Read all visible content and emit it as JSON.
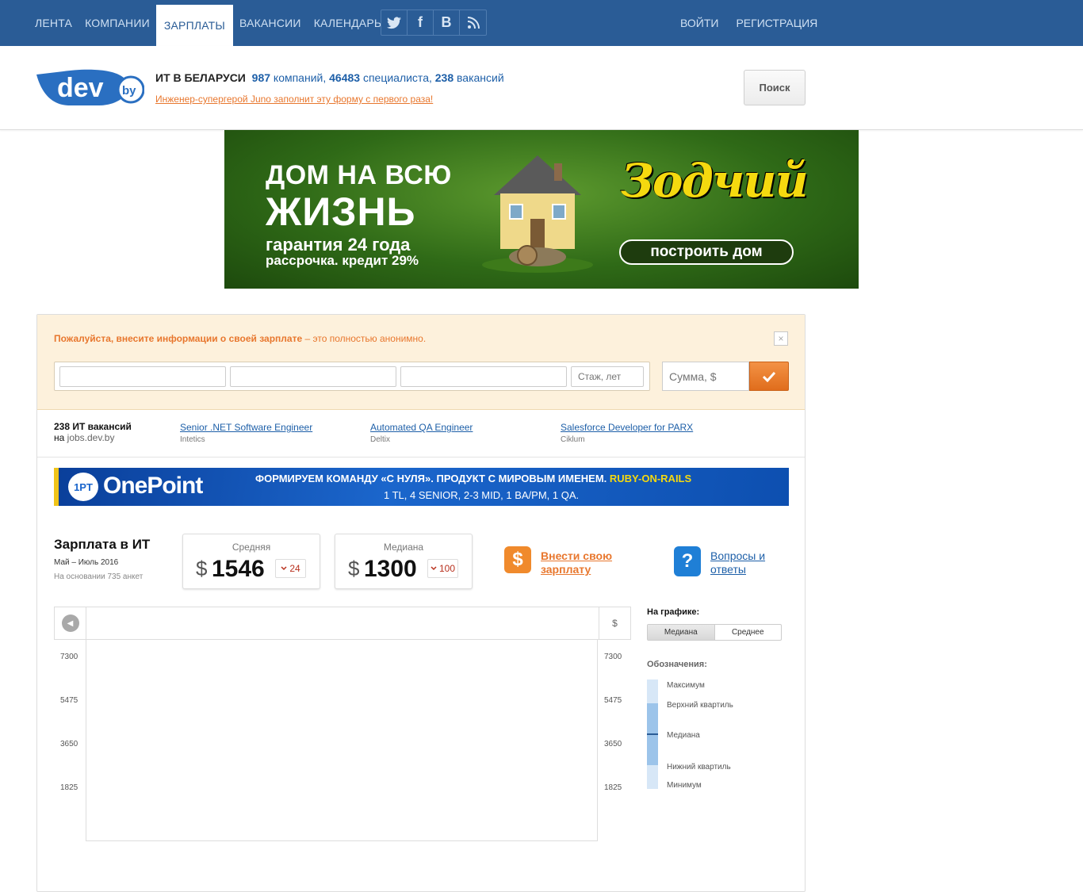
{
  "nav": {
    "items": [
      "ЛЕНТА",
      "КОМПАНИИ",
      "ЗАРПЛАТЫ",
      "ВАКАНСИИ",
      "КАЛЕНДАРЬ"
    ],
    "active": "ЗАРПЛАТЫ",
    "social": [
      "twitter-icon",
      "facebook-icon",
      "vkontakte-icon",
      "rss-icon"
    ],
    "login": "ВОЙТИ",
    "register": "РЕГИСТРАЦИЯ"
  },
  "header": {
    "logo_text": "dev",
    "logo_suffix": "by",
    "tagline_prefix": "ИТ В БЕЛАРУСИ",
    "companies_count": "987",
    "companies_label": "компаний,",
    "specialists_count": "46483",
    "specialists_label": "специалиста,",
    "vacancies_count": "238",
    "vacancies_label": "вакансий",
    "promo_link": "Инженер-супергерой Juno заполнит эту форму с первого раза!",
    "search_button": "Поиск"
  },
  "banner": {
    "line1": "ДОМ НА ВСЮ",
    "line2": "ЖИЗНЬ",
    "line3": "гарантия 24 года",
    "line4": "рассрочка. кредит 29%",
    "brand": "Зодчий",
    "button": "построить дом"
  },
  "salary_form": {
    "prompt_bold": "Пожалуйста, внесите информации о своей зарплате",
    "prompt_rest": " – это полностью анонимно.",
    "close": "×",
    "field1_placeholder": "",
    "field2_placeholder": "",
    "field3_placeholder": "",
    "experience_placeholder": "Стаж, лет",
    "sum_placeholder": "Сумма, $",
    "submit_icon": "checkmark-icon"
  },
  "jobs": {
    "count_label": "238 ИТ вакансий",
    "site_prefix": "на",
    "site": "jobs.dev.by",
    "items": [
      {
        "title": "Senior .NET Software Engineer",
        "company": "Intetics"
      },
      {
        "title": "Automated QA Engineer",
        "company": "Deltix"
      },
      {
        "title": "Salesforce Developer for PARX",
        "company": "Ciklum"
      }
    ]
  },
  "onepoint": {
    "logo": "1PT",
    "name": "OnePoint",
    "line1": "ФОРМИРУЕМ КОМАНДУ «С НУЛЯ». ПРОДУКТ С МИРОВЫМ ИМЕНЕМ.",
    "line1_accent": "RUBY-ON-RAILS",
    "line2": "1 TL, 4 SENIOR, 2-3 MID, 1 BA/PM, 1 QA."
  },
  "stats": {
    "title": "Зарплата в ИТ",
    "period": "Май – Июль 2016",
    "basis": "На основании 735 анкет",
    "average": {
      "label": "Средняя",
      "currency": "$",
      "value": "1546",
      "delta": "24"
    },
    "median": {
      "label": "Медиана",
      "currency": "$",
      "value": "1300",
      "delta": "100"
    },
    "enter_salary": "Внести свою зарплату",
    "faq": "Вопросы и ответы"
  },
  "chart_data": {
    "type": "box",
    "currency_label": "$",
    "y_ticks": [
      "7300",
      "5475",
      "3650",
      "1825"
    ],
    "series": []
  },
  "legend": {
    "title": "На графике:",
    "toggle": [
      "Медиана",
      "Среднее"
    ],
    "active": "Медиана",
    "subtitle": "Обозначения:",
    "max": "Максимум",
    "upper_quartile": "Верхний квартиль",
    "median": "Медиана",
    "lower_quartile": "Нижний квартиль",
    "min": "Минимум"
  },
  "colors": {
    "nav_bg": "#2a5c96",
    "accent_orange": "#e8772e",
    "link_blue": "#1d5fa8",
    "form_bg": "#fdf1dc"
  }
}
